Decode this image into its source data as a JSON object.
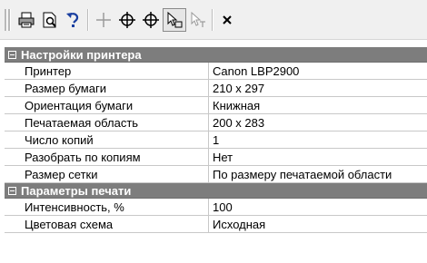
{
  "toolbar": {
    "buttons": [
      {
        "icon": "print-icon"
      },
      {
        "icon": "print-preview-icon"
      },
      {
        "icon": "undo-icon"
      },
      {
        "icon": "crosshair-icon"
      },
      {
        "icon": "target-icon"
      },
      {
        "icon": "target-alt-icon"
      },
      {
        "icon": "select-arrow-icon",
        "pressed": true
      },
      {
        "icon": "select-text-arrow-icon"
      },
      {
        "icon": "close-icon"
      }
    ]
  },
  "sections": [
    {
      "title": "Настройки принтера",
      "rows": [
        {
          "name": "Принтер",
          "value": "Canon LBP2900"
        },
        {
          "name": "Размер бумаги",
          "value": "210 x 297"
        },
        {
          "name": "Ориентация бумаги",
          "value": "Книжная"
        },
        {
          "name": "Печатаемая область",
          "value": "200 x 283"
        },
        {
          "name": "Число копий",
          "value": "1"
        },
        {
          "name": "Разобрать по копиям",
          "value": "Нет"
        },
        {
          "name": "Размер сетки",
          "value": "По размеру печатаемой области"
        }
      ]
    },
    {
      "title": "Параметры печати",
      "rows": [
        {
          "name": "Интенсивность, %",
          "value": "100"
        },
        {
          "name": "Цветовая схема",
          "value": "Исходная"
        }
      ]
    }
  ]
}
